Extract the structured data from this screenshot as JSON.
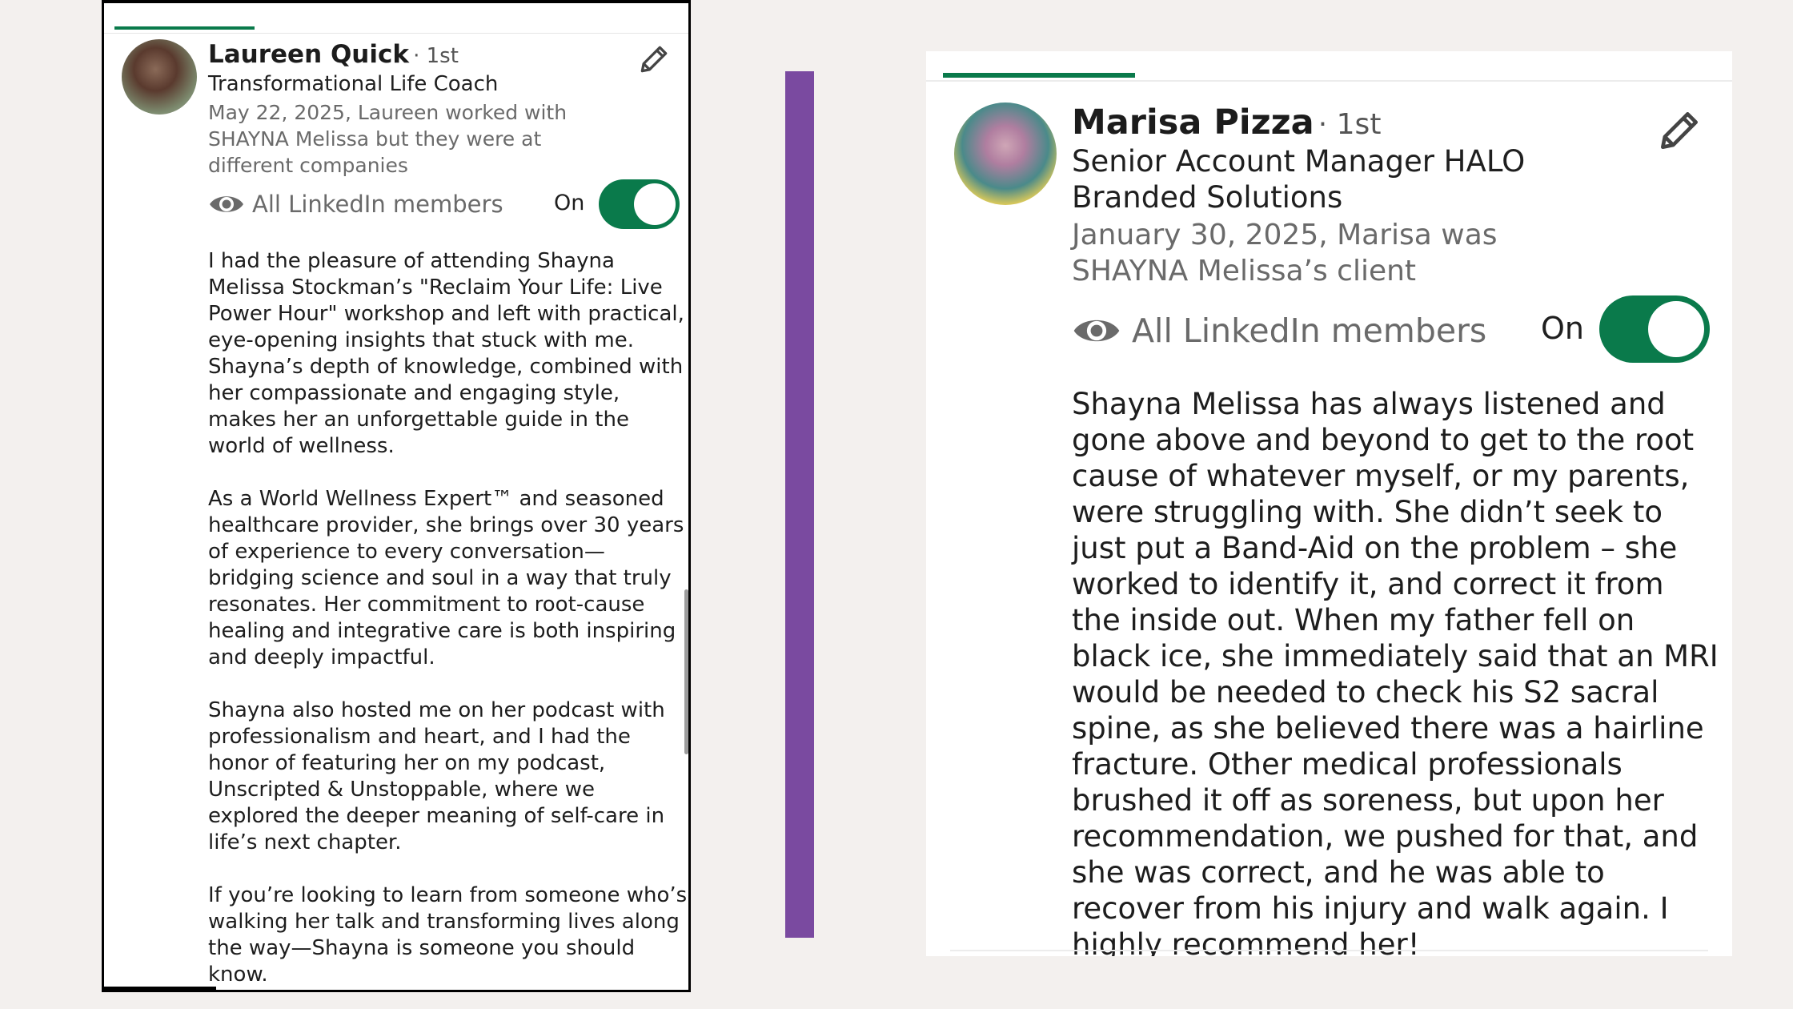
{
  "left": {
    "name": "Laureen Quick",
    "degree": "· 1st",
    "headline": "Transformational Life Coach",
    "relationship": "May 22, 2025, Laureen worked with SHAYNA Melissa but they were at different companies",
    "visibility_label": "All LinkedIn members",
    "toggle_label": "On",
    "toggle_state": "on",
    "paragraphs": [
      "I had the pleasure of attending Shayna Melissa Stockman’s \"Reclaim Your Life: Live Power Hour\" workshop and left with practical, eye-opening insights that stuck with me. Shayna’s depth of knowledge, combined with her compassionate and engaging style, makes her an unforgettable guide in the world of wellness.",
      "As a World Wellness Expert™ and seasoned healthcare provider, she brings over 30 years of experience to every conversation—bridging science and soul in a way that truly resonates. Her commitment to root-cause healing and integrative care is both inspiring and deeply impactful.",
      "Shayna also hosted me on her podcast with professionalism and heart, and I had the honor of featuring her on my podcast, Unscripted & Unstoppable, where we explored the deeper meaning of self-care in life’s next chapter.",
      "If you’re looking to learn from someone who’s walking her talk and transforming lives along the way—Shayna is someone you should know."
    ]
  },
  "right": {
    "name": "Marisa Pizza",
    "degree": "· 1st",
    "headline": "Senior Account Manager HALO Branded Solutions",
    "relationship": "January 30, 2025, Marisa was SHAYNA Melissa’s client",
    "visibility_label": "All LinkedIn members",
    "toggle_label": "On",
    "toggle_state": "on",
    "body": "Shayna Melissa has always listened and gone above and beyond to get to the root cause of whatever myself, or my parents, were struggling with. She didn’t seek to just put a Band-Aid on the problem – she worked to identify it, and correct it from the inside out. When my father fell on black ice, she immediately said that an MRI would be needed to check his S2 sacral spine, as she believed there was a hairline fracture. Other medical professionals brushed it off as soreness, but upon her recommendation, we pushed for that, and she was correct, and he was able to recover from his injury and walk again. I highly recommend her!"
  },
  "colors": {
    "accent_green": "#0a7a4b",
    "divider_purple": "#7a4aa0",
    "page_background": "#f3f0ee"
  },
  "icons": {
    "edit": "pencil-icon",
    "visibility": "eye-icon"
  }
}
